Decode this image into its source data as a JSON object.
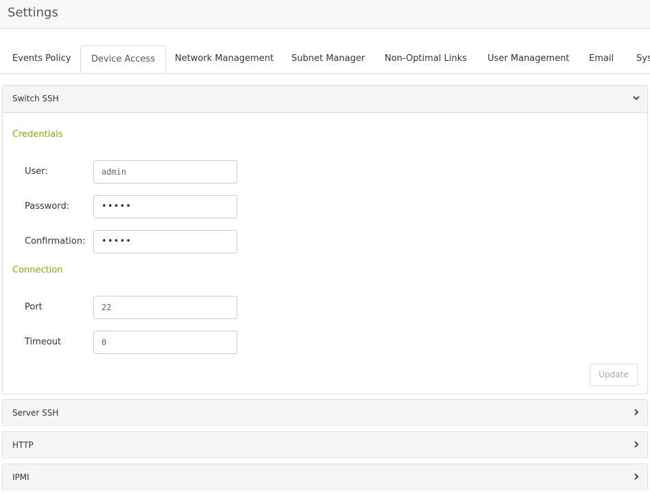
{
  "header": {
    "title": "Settings"
  },
  "tabs": [
    {
      "label": "Events Policy"
    },
    {
      "label": "Device Access",
      "active": true
    },
    {
      "label": "Network Management"
    },
    {
      "label": "Subnet Manager"
    },
    {
      "label": "Non-Optimal Links"
    },
    {
      "label": "User Management"
    },
    {
      "label": "Email"
    },
    {
      "label": "Sys"
    }
  ],
  "switch_ssh": {
    "title": "Switch SSH",
    "credentials_title": "Credentials",
    "user_label": "User:",
    "user_value": "admin",
    "password_label": "Password:",
    "password_value": "•••••",
    "confirmation_label": "Confirmation:",
    "confirmation_value": "•••••",
    "connection_title": "Connection",
    "port_label": "Port",
    "port_value": "22",
    "timeout_label": "Timeout",
    "timeout_value": "0",
    "update_label": "Update"
  },
  "collapsed_panels": [
    {
      "title": "Server SSH"
    },
    {
      "title": "HTTP"
    },
    {
      "title": "IPMI"
    }
  ],
  "colors": {
    "accent": "#76b900",
    "border": "#dddddd",
    "panel_header": "#f5f5f5"
  },
  "icons": {
    "expanded": "chevron-down-icon",
    "collapsed": "chevron-right-icon"
  }
}
